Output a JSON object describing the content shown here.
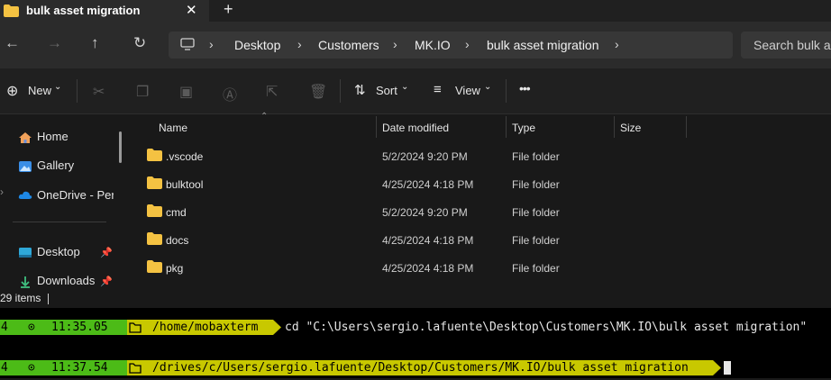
{
  "tab": {
    "title": "bulk asset migration",
    "close_icon": "close-icon",
    "new_tab": "+"
  },
  "nav": {
    "breadcrumbs": [
      "Desktop",
      "Customers",
      "MK.IO",
      "bulk asset migration"
    ],
    "search_placeholder": "Search bulk as"
  },
  "toolbar": {
    "new_label": "New",
    "sort_label": "Sort",
    "view_label": "View",
    "more": "•••"
  },
  "sidebar": {
    "items": [
      {
        "label": "Home",
        "icon": "home-icon"
      },
      {
        "label": "Gallery",
        "icon": "gallery-icon"
      },
      {
        "label": "OneDrive - Perso",
        "icon": "cloud-icon"
      },
      {
        "label": "Desktop",
        "icon": "desktop-icon"
      },
      {
        "label": "Downloads",
        "icon": "download-icon"
      }
    ]
  },
  "columns": {
    "name": "Name",
    "date": "Date modified",
    "type": "Type",
    "size": "Size"
  },
  "files": [
    {
      "name": ".vscode",
      "date": "5/2/2024 9:20 PM",
      "type": "File folder"
    },
    {
      "name": "bulktool",
      "date": "4/25/2024 4:18 PM",
      "type": "File folder"
    },
    {
      "name": "cmd",
      "date": "5/2/2024 9:20 PM",
      "type": "File folder"
    },
    {
      "name": "docs",
      "date": "4/25/2024 4:18 PM",
      "type": "File folder"
    },
    {
      "name": "pkg",
      "date": "4/25/2024 4:18 PM",
      "type": "File folder"
    }
  ],
  "status": {
    "item_count": "29 items"
  },
  "terminal": {
    "lines": [
      {
        "num": "4",
        "clock_icon": "⊙",
        "time": "11:35.05",
        "path": "/home/mobaxterm",
        "command": "cd \"C:\\Users\\sergio.lafuente\\Desktop\\Customers\\MK.IO\\bulk asset migration\""
      },
      {
        "num": "4",
        "clock_icon": "⊙",
        "time": "11:37.54",
        "path": "/drives/c/Users/sergio.lafuente/Desktop/Customers/MK.IO/bulk asset migration",
        "command": ""
      }
    ]
  },
  "colors": {
    "terminal_green": "#4cbb17",
    "terminal_yellow": "#c8c800",
    "folder_yellow": "#f4c242"
  }
}
